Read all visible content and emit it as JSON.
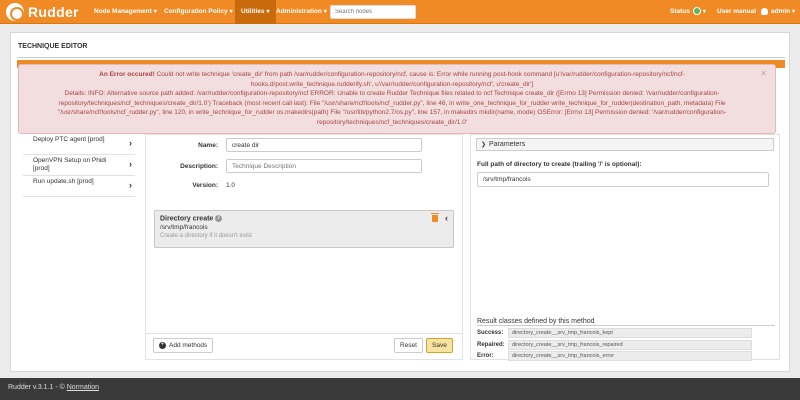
{
  "navbar": {
    "brand": "Rudder",
    "menu": [
      {
        "label": "Node Management"
      },
      {
        "label": "Configuration Policy"
      },
      {
        "label": "Utilities"
      },
      {
        "label": "Administration"
      }
    ],
    "search_placeholder": "Search nodes",
    "status_label": "Status",
    "user_manual_label": "User manual",
    "user_label": "admin"
  },
  "page": {
    "title": "TECHNIQUE EDITOR"
  },
  "error": {
    "heading": "An Error occured!",
    "lines": [
      "Could not write technique 'create_dir' from path /var/rudder/configuration-repository/ncf, cause is: Error while running post-hook command [u'/var/rudder/configuration-repository/ncf/ncf-",
      "hooks.d/post.write_technique.rudderify.sh', u'/var/rudder/configuration-repository/ncf', u'create_dir']",
      "Details: INFO: Alternative source path added: /var/rudder/configuration-repository/ncf ERROR: Unable to create Rudder Technique files related to ncf Technique create_dir ([Errno 13] Permission denied: '/var/rudder/configuration-",
      "repository/techniques/ncf_techniques/create_dir/1.0') Traceback (most recent call last): File \"/usr/share/ncf/tools/ncf_rudder.py\", line 46, in write_one_technique_for_rudder write_technique_for_rudder(destination_path, metadata) File",
      "\"/usr/share/ncf/tools/ncf_rudder.py\", line 120, in write_technique_for_rudder os.makedirs(path) File \"/usr/lib/python2.7/os.py\", line 157, in makedirs mkdir(name, mode) OSError: [Errno 13] Permission denied: '/var/rudder/configuration-",
      "repository/techniques/ncf_techniques/create_dir/1.0'"
    ]
  },
  "techniques": [
    {
      "label": "Deploy PTC agent [prod]"
    },
    {
      "label": "OpenVPN Setup on Phidi [prod]"
    },
    {
      "label": "Run update.sh [prod]"
    }
  ],
  "form": {
    "name_label": "Name:",
    "name_value": "create dir",
    "description_label": "Description:",
    "description_placeholder": "Technique Description",
    "version_label": "Version:",
    "version_value": "1.0"
  },
  "method": {
    "title": "Directory create",
    "param": "/srv/tmp/francois",
    "description": "Create a directory if it doesn't exist"
  },
  "actions": {
    "add_methods": "Add methods",
    "reset": "Reset",
    "save": "Save"
  },
  "parameters": {
    "header": "Parameters",
    "path_label": "Full path of directory to create (trailing '/' is optional):",
    "path_value": "/srv/tmp/francois"
  },
  "results": {
    "title": "Result classes defined by this method",
    "rows": [
      {
        "label": "Success:",
        "value": "directory_create__srv_tmp_francois_kept"
      },
      {
        "label": "Repaired:",
        "value": "directory_create__srv_tmp_francois_repaired"
      },
      {
        "label": "Error:",
        "value": "directory_create__srv_tmp_francois_error"
      }
    ]
  },
  "footer": {
    "version_text": "Rudder v.3.1.1 - ©",
    "company_link": "Normation"
  },
  "colors": {
    "brand_orange": "#f08a24",
    "error_bg": "#f2dede",
    "error_text": "#a94442",
    "save_button": "#f8e3a0"
  }
}
